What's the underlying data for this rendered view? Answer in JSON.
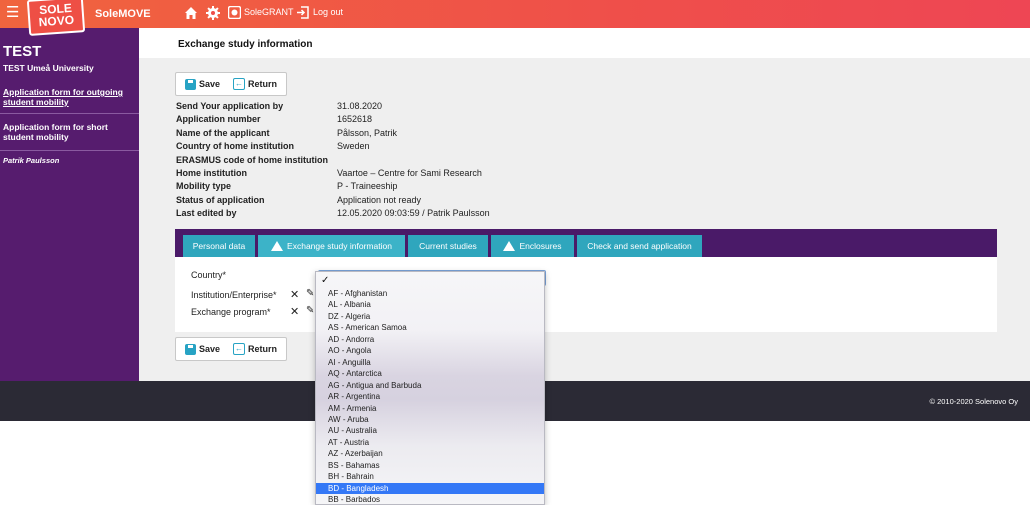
{
  "topbar": {
    "logo_line1": "SOLE",
    "logo_line2": "NOVO",
    "app_name": "SoleMOVE",
    "menu_icon": "hamburger-icon",
    "home_icon": "home-icon",
    "settings_icon": "gear-icon",
    "grant_icon": "grant-icon",
    "grant_label": "SoleGRANT",
    "logout_icon": "logout-icon",
    "logout_label": "Log out",
    "bar_color": "#ef4f4a"
  },
  "sidebar": {
    "title": "TEST",
    "subtitle": "TEST Umeå University",
    "links": [
      {
        "label": "Application form for outgoing student mobility"
      },
      {
        "label": "Application form for short student mobility"
      }
    ],
    "user": "Patrik Paulsson",
    "bg_color": "#561c6e"
  },
  "main": {
    "title": "Exchange study information",
    "save_label": "Save",
    "return_label": "Return",
    "info": [
      {
        "key": "Send Your application by",
        "value": "31.08.2020"
      },
      {
        "key": "Application number",
        "value": "1652618"
      },
      {
        "key": "Name of the applicant",
        "value": "Pålsson, Patrik"
      },
      {
        "key": "Country of home institution",
        "value": "Sweden"
      },
      {
        "key": "ERASMUS code of home institution",
        "value": ""
      },
      {
        "key": "Home institution",
        "value": "Vaartoe – Centre for Sami Research"
      },
      {
        "key": "Mobility type",
        "value": "P - Traineeship"
      },
      {
        "key": "Status of application",
        "value": "Application not ready"
      },
      {
        "key": "Last edited by",
        "value": "12.05.2020 09:03:59 / Patrik Paulsson"
      }
    ],
    "tabs": [
      {
        "label": "Personal data",
        "warning": false
      },
      {
        "label": "Exchange study information",
        "warning": true
      },
      {
        "label": "Current studies",
        "warning": false
      },
      {
        "label": "Enclosures",
        "warning": true
      },
      {
        "label": "Check and send application",
        "warning": false
      }
    ],
    "form": {
      "country_label": "Country*",
      "institution_label": "Institution/Enterprise*",
      "program_label": "Exchange program*",
      "clear_icon": "close-icon",
      "edit_icon": "pencil-icon"
    }
  },
  "dropdown": {
    "check_icon": "checkmark-icon",
    "options": [
      "AF - Afghanistan",
      "AL - Albania",
      "DZ - Algeria",
      "AS - American Samoa",
      "AD - Andorra",
      "AO - Angola",
      "AI - Anguilla",
      "AQ - Antarctica",
      "AG - Antigua and Barbuda",
      "AR - Argentina",
      "AM - Armenia",
      "AW - Aruba",
      "AU - Australia",
      "AT - Austria",
      "AZ - Azerbaijan",
      "BS - Bahamas",
      "BH - Bahrain",
      "BD - Bangladesh",
      "BB - Barbados"
    ],
    "highlighted": "BD - Bangladesh",
    "highlight_color": "#3478f6"
  },
  "footer": {
    "copyright": "© 2010-2020   Solenovo Oy"
  }
}
